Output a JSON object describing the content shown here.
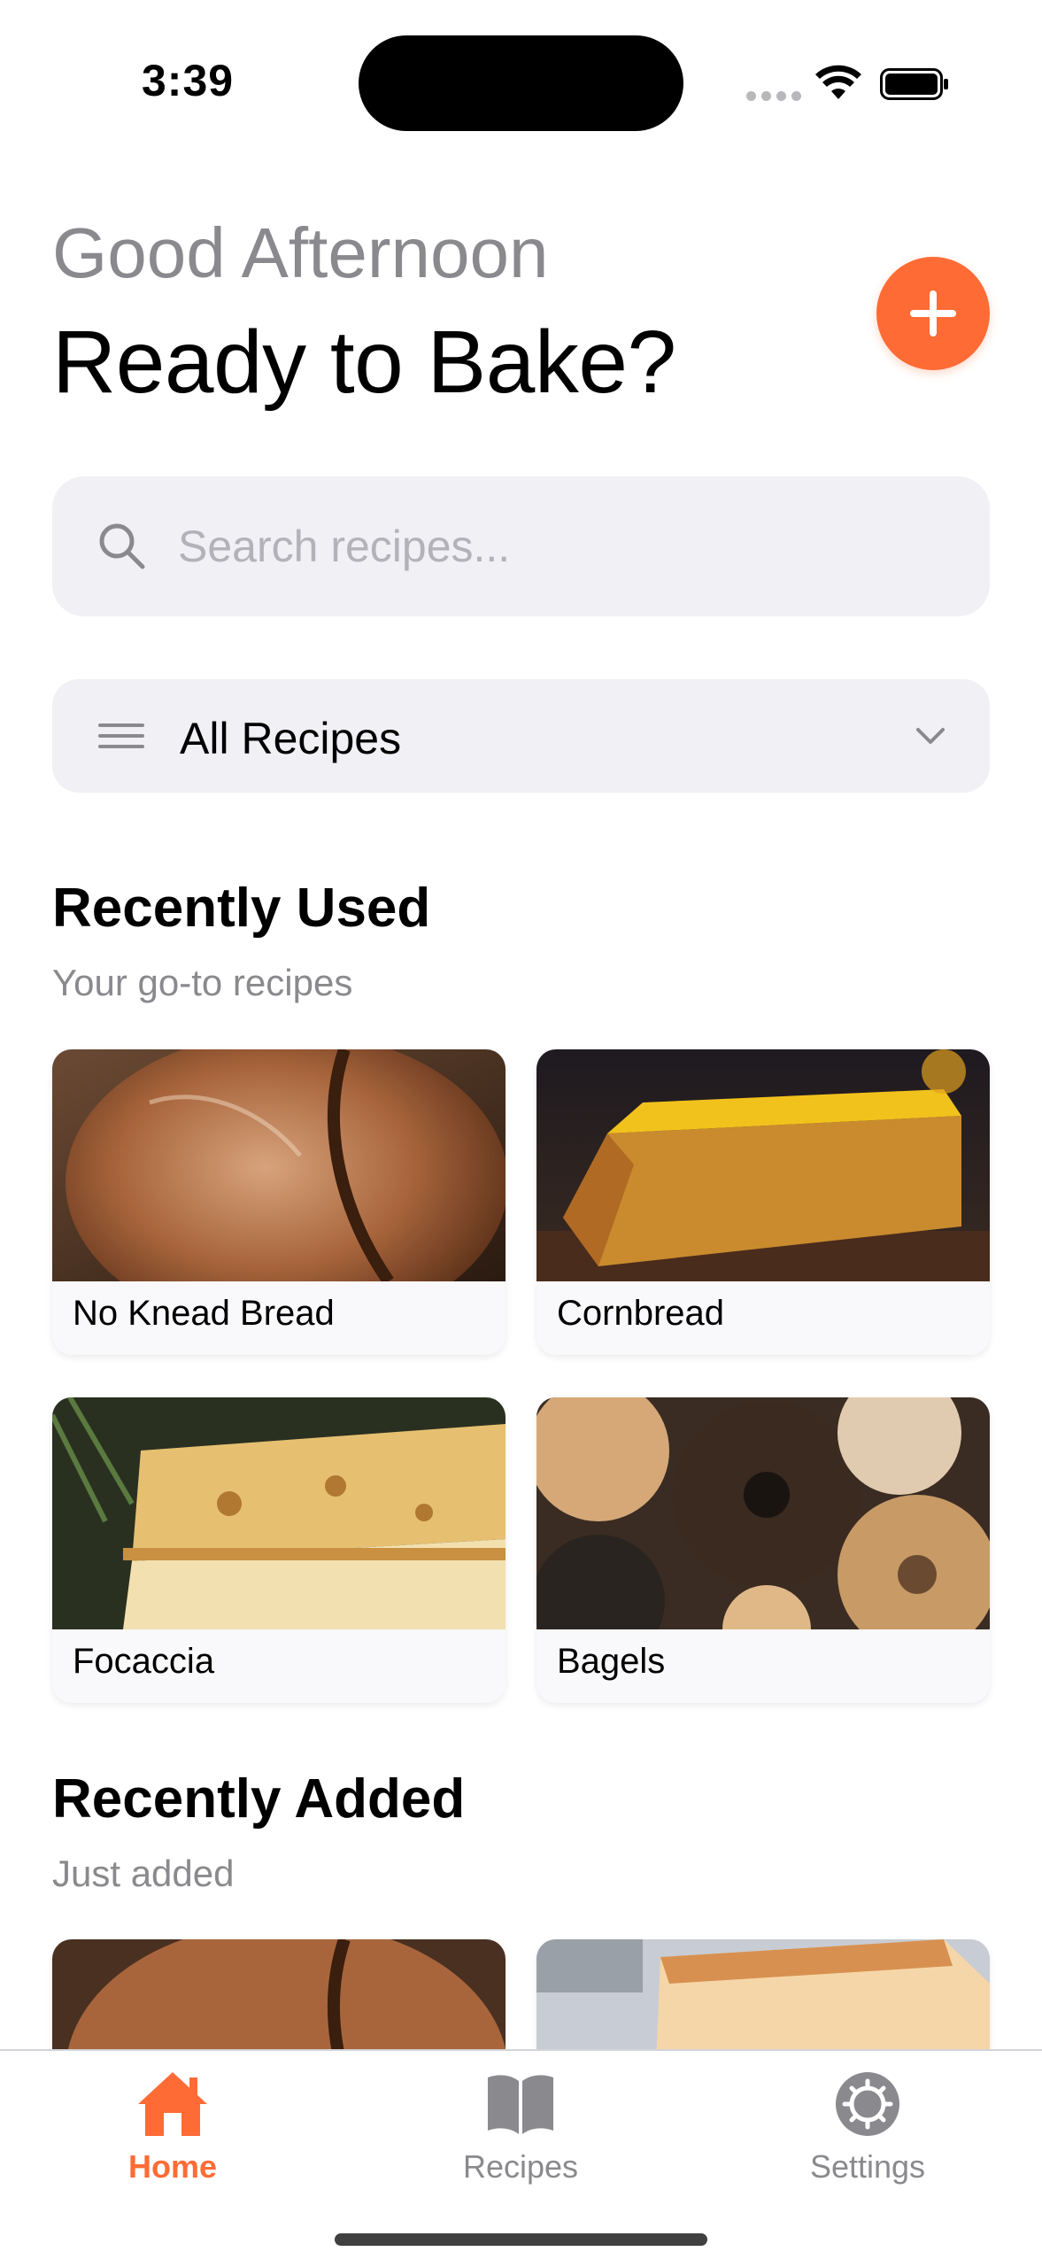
{
  "status_bar": {
    "time": "3:39"
  },
  "header": {
    "greeting": "Good Afternoon",
    "headline": "Ready to Bake?"
  },
  "search": {
    "placeholder": "Search recipes..."
  },
  "filter": {
    "selected": "All Recipes"
  },
  "recently_used": {
    "title": "Recently Used",
    "subtitle": "Your go-to recipes",
    "items": [
      {
        "label": "No Knead Bread",
        "image": "bread-loaf-image"
      },
      {
        "label": "Cornbread",
        "image": "cornbread-image"
      },
      {
        "label": "Focaccia",
        "image": "focaccia-image"
      },
      {
        "label": "Bagels",
        "image": "bagels-image"
      }
    ]
  },
  "recently_added": {
    "title": "Recently Added",
    "subtitle": "Just added",
    "items": [
      {
        "image": "bread-loaf-image"
      },
      {
        "image": "sandwich-bread-image"
      }
    ]
  },
  "tab_bar": {
    "tabs": [
      {
        "label": "Home",
        "icon": "home-icon",
        "active": true
      },
      {
        "label": "Recipes",
        "icon": "book-icon",
        "active": false
      },
      {
        "label": "Settings",
        "icon": "gear-icon",
        "active": false
      }
    ]
  },
  "colors": {
    "accent": "#ff6b35",
    "inactive": "#8a8a8e",
    "field_background": "#f0f0f5"
  }
}
